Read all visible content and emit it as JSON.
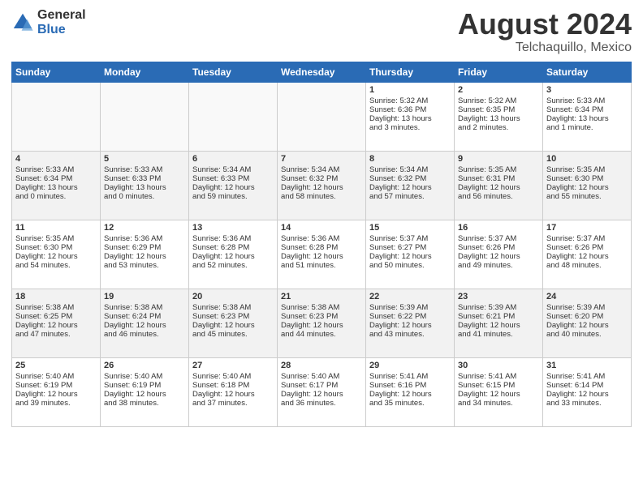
{
  "header": {
    "logo_general": "General",
    "logo_blue": "Blue",
    "month_title": "August 2024",
    "location": "Telchaquillo, Mexico"
  },
  "days_of_week": [
    "Sunday",
    "Monday",
    "Tuesday",
    "Wednesday",
    "Thursday",
    "Friday",
    "Saturday"
  ],
  "weeks": [
    {
      "days": [
        {
          "num": "",
          "content": ""
        },
        {
          "num": "",
          "content": ""
        },
        {
          "num": "",
          "content": ""
        },
        {
          "num": "",
          "content": ""
        },
        {
          "num": "1",
          "content": "Sunrise: 5:32 AM\nSunset: 6:36 PM\nDaylight: 13 hours\nand 3 minutes."
        },
        {
          "num": "2",
          "content": "Sunrise: 5:32 AM\nSunset: 6:35 PM\nDaylight: 13 hours\nand 2 minutes."
        },
        {
          "num": "3",
          "content": "Sunrise: 5:33 AM\nSunset: 6:34 PM\nDaylight: 13 hours\nand 1 minute."
        }
      ]
    },
    {
      "days": [
        {
          "num": "4",
          "content": "Sunrise: 5:33 AM\nSunset: 6:34 PM\nDaylight: 13 hours\nand 0 minutes."
        },
        {
          "num": "5",
          "content": "Sunrise: 5:33 AM\nSunset: 6:33 PM\nDaylight: 13 hours\nand 0 minutes."
        },
        {
          "num": "6",
          "content": "Sunrise: 5:34 AM\nSunset: 6:33 PM\nDaylight: 12 hours\nand 59 minutes."
        },
        {
          "num": "7",
          "content": "Sunrise: 5:34 AM\nSunset: 6:32 PM\nDaylight: 12 hours\nand 58 minutes."
        },
        {
          "num": "8",
          "content": "Sunrise: 5:34 AM\nSunset: 6:32 PM\nDaylight: 12 hours\nand 57 minutes."
        },
        {
          "num": "9",
          "content": "Sunrise: 5:35 AM\nSunset: 6:31 PM\nDaylight: 12 hours\nand 56 minutes."
        },
        {
          "num": "10",
          "content": "Sunrise: 5:35 AM\nSunset: 6:30 PM\nDaylight: 12 hours\nand 55 minutes."
        }
      ]
    },
    {
      "days": [
        {
          "num": "11",
          "content": "Sunrise: 5:35 AM\nSunset: 6:30 PM\nDaylight: 12 hours\nand 54 minutes."
        },
        {
          "num": "12",
          "content": "Sunrise: 5:36 AM\nSunset: 6:29 PM\nDaylight: 12 hours\nand 53 minutes."
        },
        {
          "num": "13",
          "content": "Sunrise: 5:36 AM\nSunset: 6:28 PM\nDaylight: 12 hours\nand 52 minutes."
        },
        {
          "num": "14",
          "content": "Sunrise: 5:36 AM\nSunset: 6:28 PM\nDaylight: 12 hours\nand 51 minutes."
        },
        {
          "num": "15",
          "content": "Sunrise: 5:37 AM\nSunset: 6:27 PM\nDaylight: 12 hours\nand 50 minutes."
        },
        {
          "num": "16",
          "content": "Sunrise: 5:37 AM\nSunset: 6:26 PM\nDaylight: 12 hours\nand 49 minutes."
        },
        {
          "num": "17",
          "content": "Sunrise: 5:37 AM\nSunset: 6:26 PM\nDaylight: 12 hours\nand 48 minutes."
        }
      ]
    },
    {
      "days": [
        {
          "num": "18",
          "content": "Sunrise: 5:38 AM\nSunset: 6:25 PM\nDaylight: 12 hours\nand 47 minutes."
        },
        {
          "num": "19",
          "content": "Sunrise: 5:38 AM\nSunset: 6:24 PM\nDaylight: 12 hours\nand 46 minutes."
        },
        {
          "num": "20",
          "content": "Sunrise: 5:38 AM\nSunset: 6:23 PM\nDaylight: 12 hours\nand 45 minutes."
        },
        {
          "num": "21",
          "content": "Sunrise: 5:38 AM\nSunset: 6:23 PM\nDaylight: 12 hours\nand 44 minutes."
        },
        {
          "num": "22",
          "content": "Sunrise: 5:39 AM\nSunset: 6:22 PM\nDaylight: 12 hours\nand 43 minutes."
        },
        {
          "num": "23",
          "content": "Sunrise: 5:39 AM\nSunset: 6:21 PM\nDaylight: 12 hours\nand 41 minutes."
        },
        {
          "num": "24",
          "content": "Sunrise: 5:39 AM\nSunset: 6:20 PM\nDaylight: 12 hours\nand 40 minutes."
        }
      ]
    },
    {
      "days": [
        {
          "num": "25",
          "content": "Sunrise: 5:40 AM\nSunset: 6:19 PM\nDaylight: 12 hours\nand 39 minutes."
        },
        {
          "num": "26",
          "content": "Sunrise: 5:40 AM\nSunset: 6:19 PM\nDaylight: 12 hours\nand 38 minutes."
        },
        {
          "num": "27",
          "content": "Sunrise: 5:40 AM\nSunset: 6:18 PM\nDaylight: 12 hours\nand 37 minutes."
        },
        {
          "num": "28",
          "content": "Sunrise: 5:40 AM\nSunset: 6:17 PM\nDaylight: 12 hours\nand 36 minutes."
        },
        {
          "num": "29",
          "content": "Sunrise: 5:41 AM\nSunset: 6:16 PM\nDaylight: 12 hours\nand 35 minutes."
        },
        {
          "num": "30",
          "content": "Sunrise: 5:41 AM\nSunset: 6:15 PM\nDaylight: 12 hours\nand 34 minutes."
        },
        {
          "num": "31",
          "content": "Sunrise: 5:41 AM\nSunset: 6:14 PM\nDaylight: 12 hours\nand 33 minutes."
        }
      ]
    }
  ]
}
